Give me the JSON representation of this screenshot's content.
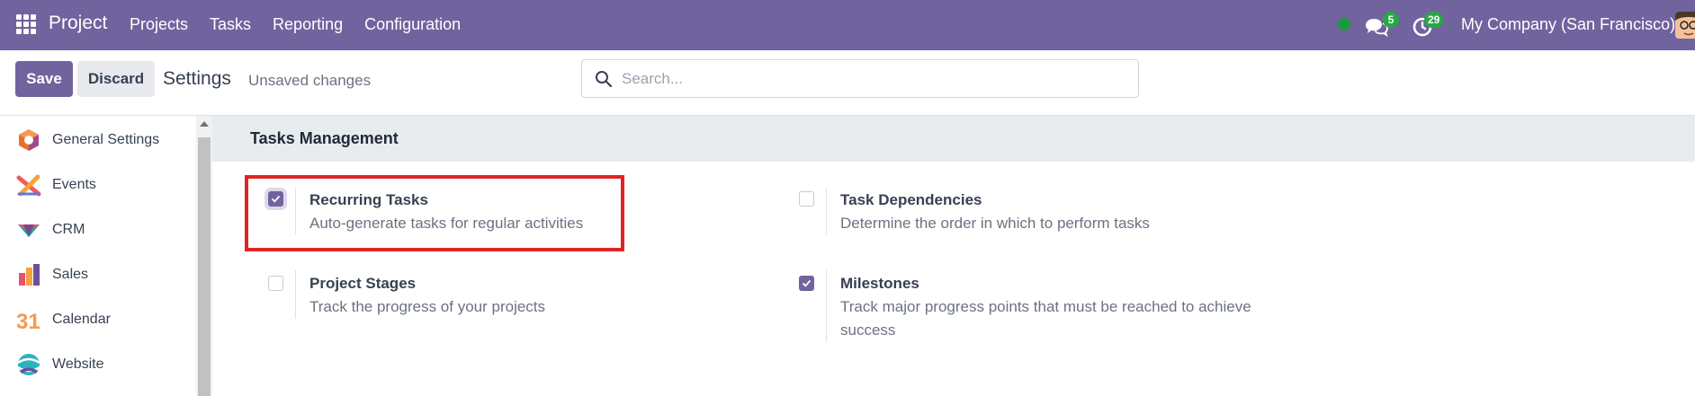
{
  "navbar": {
    "brand": "Project",
    "menu": [
      "Projects",
      "Tasks",
      "Reporting",
      "Configuration"
    ],
    "messages_count": "5",
    "activities_count": "29",
    "company": "My Company (San Francisco)"
  },
  "control": {
    "save_label": "Save",
    "discard_label": "Discard",
    "title": "Settings",
    "status": "Unsaved changes",
    "search_placeholder": "Search..."
  },
  "sidebar": {
    "items": [
      {
        "label": "General Settings",
        "icon": "general-settings-icon"
      },
      {
        "label": "Events",
        "icon": "events-icon"
      },
      {
        "label": "CRM",
        "icon": "crm-icon"
      },
      {
        "label": "Sales",
        "icon": "sales-icon"
      },
      {
        "label": "Calendar",
        "icon": "calendar-icon",
        "glyph": "31"
      },
      {
        "label": "Website",
        "icon": "website-icon"
      }
    ]
  },
  "main": {
    "section_title": "Tasks Management",
    "settings": [
      {
        "title": "Recurring Tasks",
        "desc": "Auto-generate tasks for regular activities",
        "checked": true
      },
      {
        "title": "Task Dependencies",
        "desc": "Determine the order in which to perform tasks",
        "checked": false
      },
      {
        "title": "Project Stages",
        "desc": "Track the progress of your projects",
        "checked": false
      },
      {
        "title": "Milestones",
        "desc": "Track major progress points that must be reached to achieve success",
        "checked": true
      }
    ]
  },
  "colors": {
    "brand": "#71639e",
    "highlight": "#e02424",
    "badge": "#28a745",
    "online": "#1a9c3e"
  }
}
